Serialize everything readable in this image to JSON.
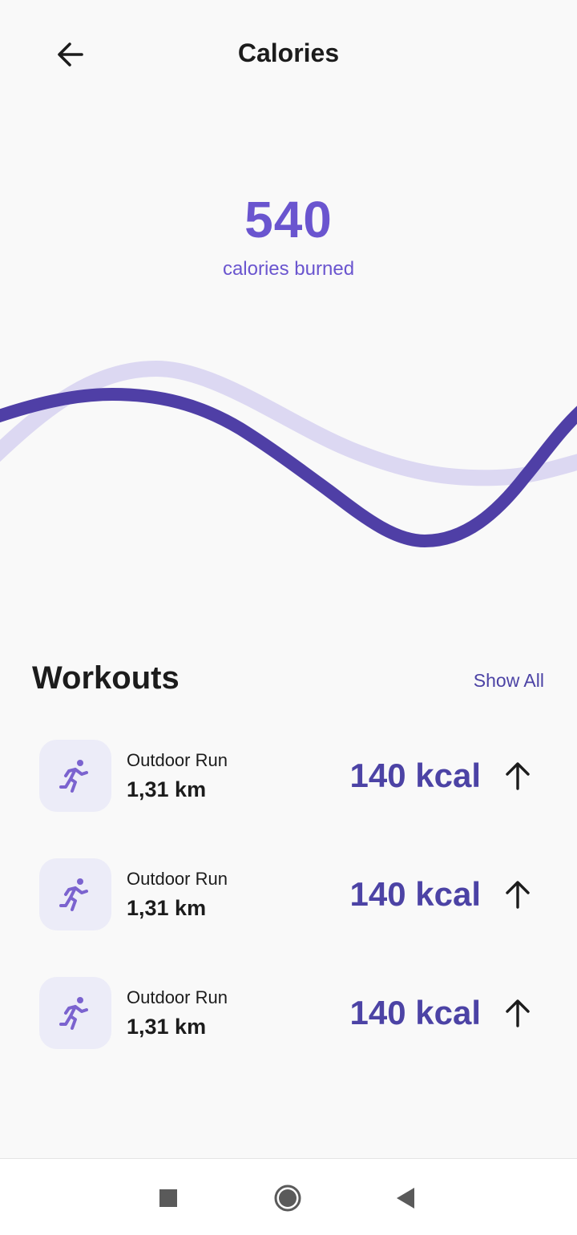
{
  "header": {
    "title": "Calories",
    "back_icon": "arrow-left-icon"
  },
  "summary": {
    "value": "540",
    "caption": "calories burned",
    "accent_color": "#6a55cf"
  },
  "workouts": {
    "title": "Workouts",
    "show_all_label": "Show All",
    "items": [
      {
        "type": "Outdoor Run",
        "distance": "1,31 km",
        "calories": "140 kcal",
        "icon": "running-person-icon",
        "trend_icon": "arrow-up-icon"
      },
      {
        "type": "Outdoor Run",
        "distance": "1,31 km",
        "calories": "140 kcal",
        "icon": "running-person-icon",
        "trend_icon": "arrow-up-icon"
      },
      {
        "type": "Outdoor Run",
        "distance": "1,31 km",
        "calories": "140 kcal",
        "icon": "running-person-icon",
        "trend_icon": "arrow-up-icon"
      }
    ]
  },
  "colors": {
    "primary_wave": "#4f3fa6",
    "secondary_wave": "#dcd8f2",
    "kcal_text": "#4c43a5"
  },
  "system_nav": {
    "icons": [
      "recent-apps-icon",
      "home-icon",
      "back-triangle-icon"
    ]
  }
}
